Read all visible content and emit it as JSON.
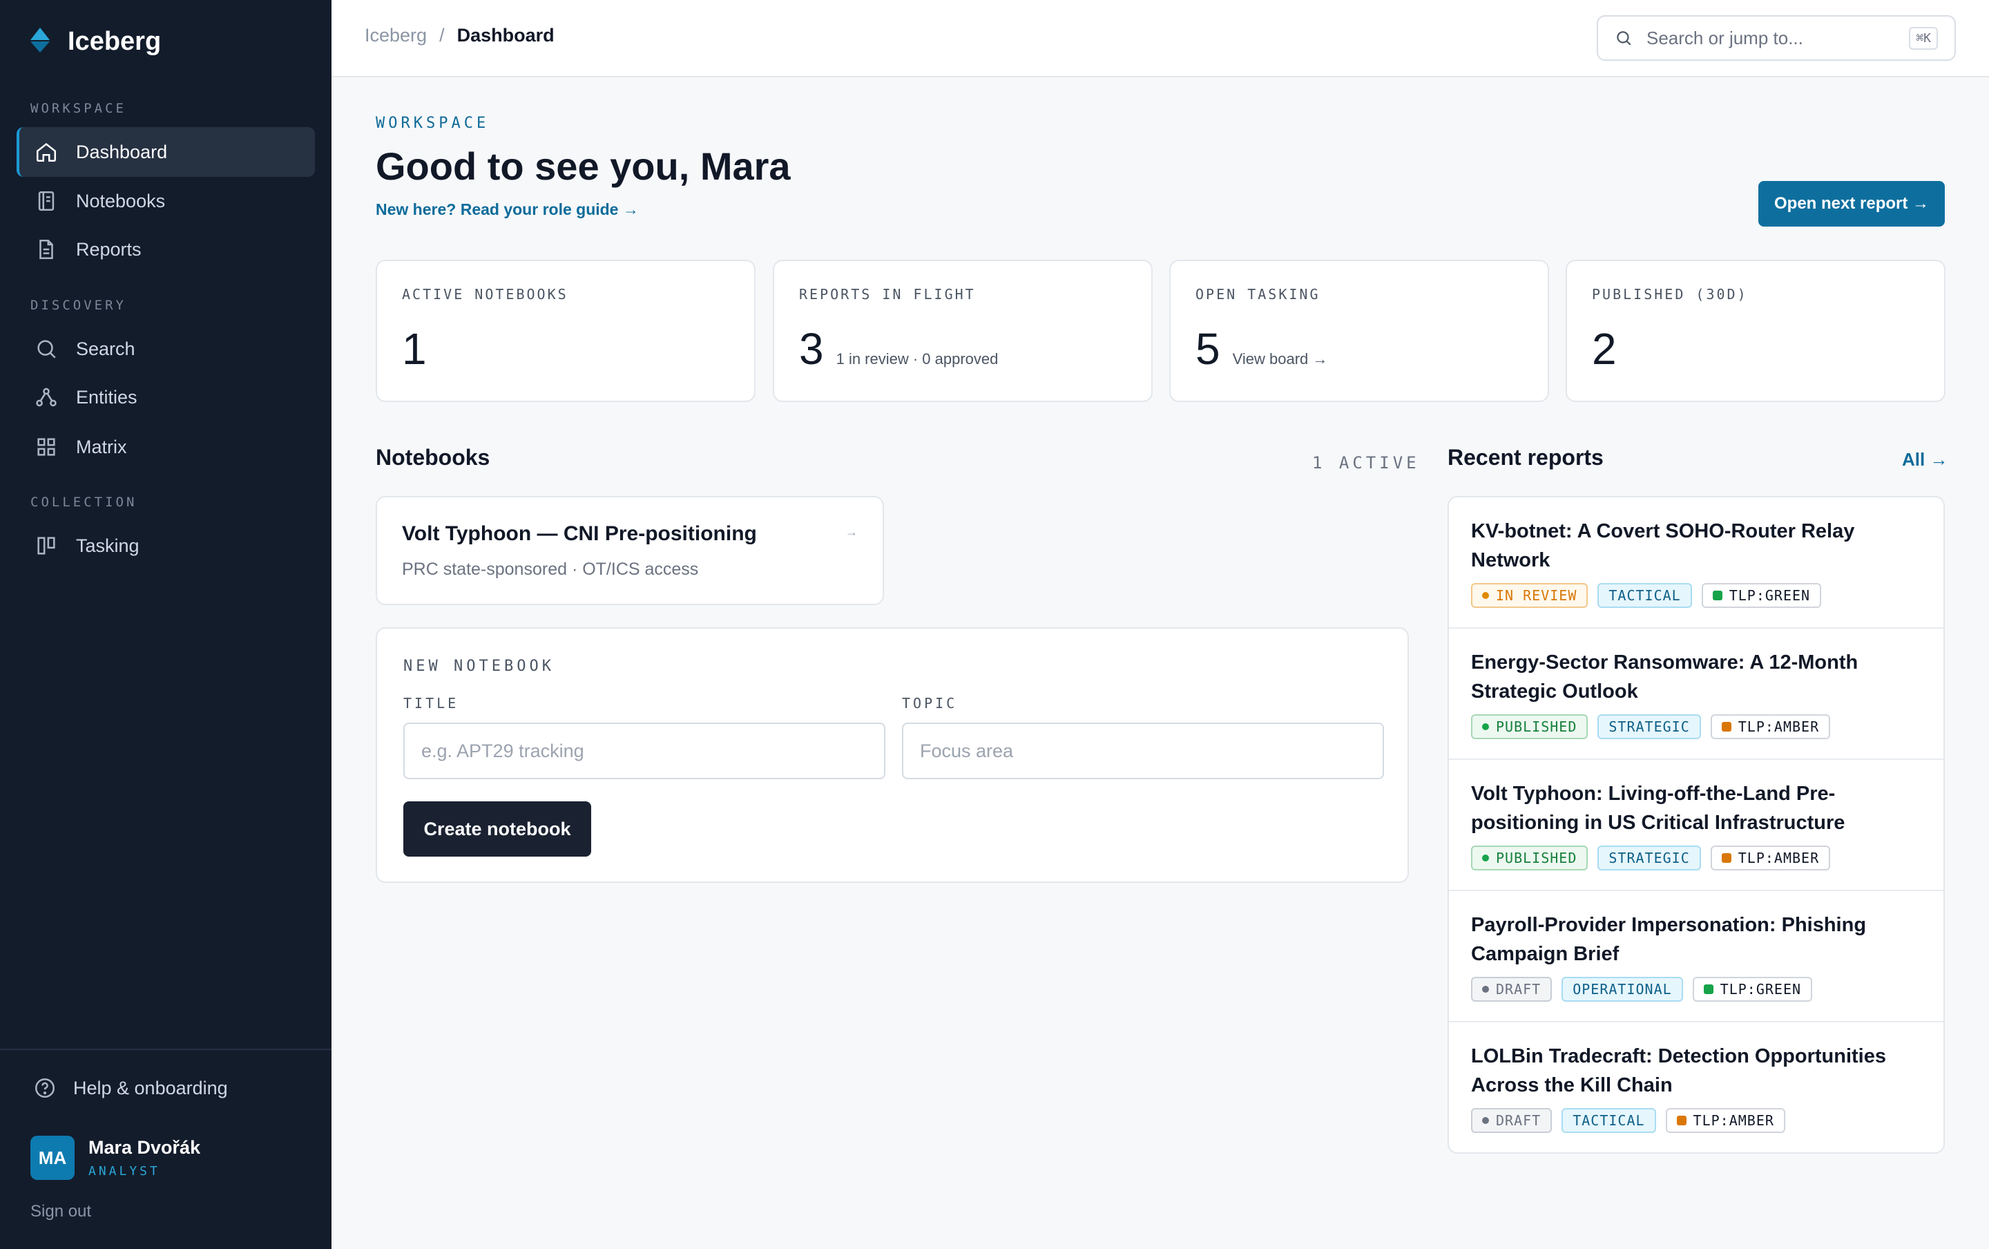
{
  "app": {
    "name": "Iceberg"
  },
  "sidebar": {
    "sections": [
      {
        "label": "WORKSPACE"
      },
      {
        "label": "DISCOVERY"
      },
      {
        "label": "COLLECTION"
      }
    ],
    "items": [
      {
        "label": "Dashboard",
        "icon": "home-icon",
        "active": true
      },
      {
        "label": "Notebooks",
        "icon": "notebook-icon"
      },
      {
        "label": "Reports",
        "icon": "document-icon"
      },
      {
        "label": "Search",
        "icon": "search-icon"
      },
      {
        "label": "Entities",
        "icon": "graph-icon"
      },
      {
        "label": "Matrix",
        "icon": "grid-icon"
      },
      {
        "label": "Tasking",
        "icon": "kanban-icon"
      }
    ],
    "help": "Help & onboarding",
    "user": {
      "initials": "MA",
      "name": "Mara Dvořák",
      "role": "ANALYST"
    },
    "signout": "Sign out"
  },
  "topbar": {
    "breadcrumb": [
      "Iceberg",
      "/",
      "Dashboard"
    ],
    "search": {
      "placeholder": "Search or jump to...",
      "shortcut": "⌘K"
    }
  },
  "main": {
    "eyebrow": "WORKSPACE",
    "greeting": "Good to see you, Mara",
    "guide_link": "New here? Read your role guide →",
    "primary_button": "Open next report →",
    "stats": [
      {
        "label": "ACTIVE NOTEBOOKS",
        "value": "1",
        "sub": ""
      },
      {
        "label": "REPORTS IN FLIGHT",
        "value": "3",
        "sub": "1 in review · 0 approved"
      },
      {
        "label": "OPEN TASKING",
        "value": "5",
        "sub": "View board →"
      },
      {
        "label": "PUBLISHED (30D)",
        "value": "2",
        "sub": ""
      }
    ],
    "notebooks": {
      "heading": "Notebooks",
      "count_label": "1 ACTIVE",
      "items": [
        {
          "title": "Volt Typhoon — CNI Pre-positioning",
          "subtitle": "PRC state-sponsored · OT/ICS access",
          "arrow": "→"
        }
      ]
    },
    "new_notebook": {
      "heading": "NEW NOTEBOOK",
      "title_label": "TITLE",
      "title_placeholder": "e.g. APT29 tracking",
      "topic_label": "TOPIC",
      "topic_placeholder": "Focus area",
      "button": "Create notebook"
    },
    "recent_reports": {
      "heading": "Recent reports",
      "all_link": "All →",
      "items": [
        {
          "title": "KV-botnet: A Covert SOHO-Router Relay Network",
          "status": "IN REVIEW",
          "type": "TACTICAL",
          "tlp": "TLP:GREEN"
        },
        {
          "title": "Energy-Sector Ransomware: A 12-Month Strategic Outlook",
          "status": "PUBLISHED",
          "type": "STRATEGIC",
          "tlp": "TLP:AMBER"
        },
        {
          "title": "Volt Typhoon: Living-off-the-Land Pre-positioning in US Critical Infrastructure",
          "status": "PUBLISHED",
          "type": "STRATEGIC",
          "tlp": "TLP:AMBER"
        },
        {
          "title": "Payroll-Provider Impersonation: Phishing Campaign Brief",
          "status": "DRAFT",
          "type": "OPERATIONAL",
          "tlp": "TLP:GREEN"
        },
        {
          "title": "LOLBin Tradecraft: Detection Opportunities Across the Kill Chain",
          "status": "DRAFT",
          "type": "TACTICAL",
          "tlp": "TLP:AMBER"
        }
      ]
    }
  },
  "colors": {
    "sidebar_bg": "#131c2b",
    "accent": "#0e6f9e",
    "status_in_review": "#e08a00",
    "status_published": "#16803c",
    "status_draft": "#6b7280",
    "tlp_green": "#16a34a",
    "tlp_amber": "#d97706"
  }
}
